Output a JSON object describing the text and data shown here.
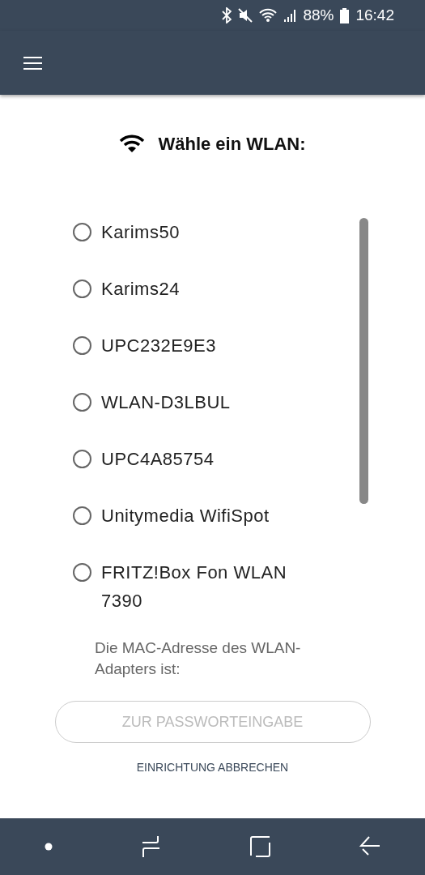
{
  "status_bar": {
    "battery": "88%",
    "time": "16:42"
  },
  "title": "Wähle ein WLAN:",
  "networks": [
    {
      "name": "Karims50",
      "selected": false
    },
    {
      "name": "Karims24",
      "selected": false
    },
    {
      "name": "UPC232E9E3",
      "selected": false
    },
    {
      "name": "WLAN-D3LBUL",
      "selected": false
    },
    {
      "name": "UPC4A85754",
      "selected": false
    },
    {
      "name": "Unitymedia WifiSpot",
      "selected": false
    },
    {
      "name": "FRITZ!Box Fon WLAN 7390",
      "selected": false
    }
  ],
  "mac_text": "Die MAC-Adresse des WLAN-Adapters ist:",
  "primary_button": {
    "label": "ZUR PASSWORTEINGABE",
    "disabled": true
  },
  "cancel_link": "EINRICHTUNG ABBRECHEN"
}
